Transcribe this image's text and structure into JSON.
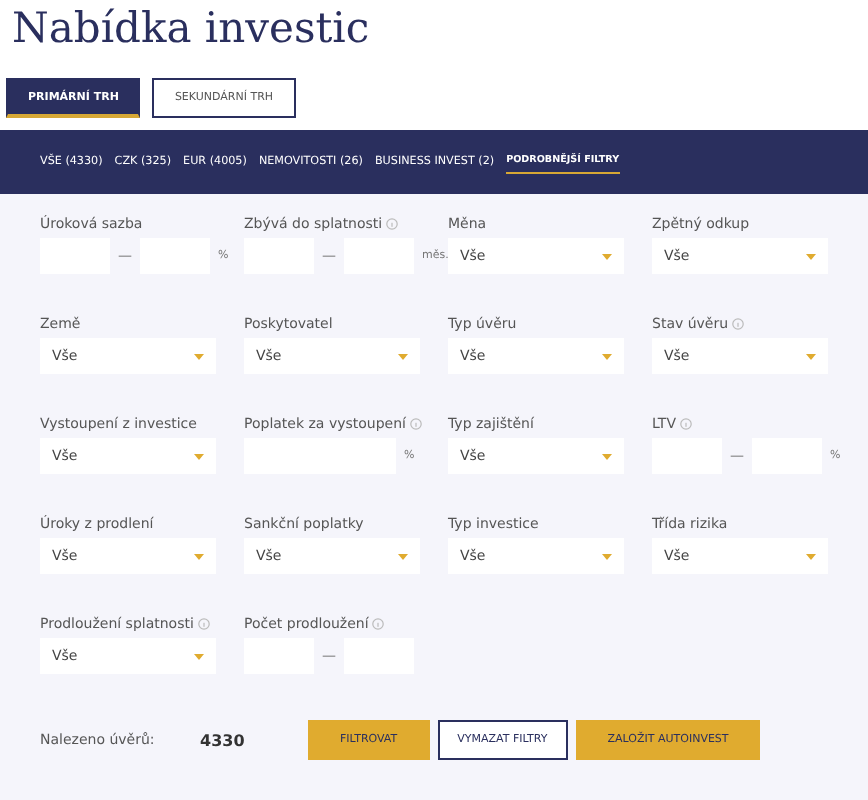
{
  "title": "Nabídka investic",
  "market_tabs": [
    {
      "label": "PRIMÁRNÍ TRH",
      "selected": true
    },
    {
      "label": "SEKUNDÁRNÍ TRH",
      "selected": false
    }
  ],
  "nav": [
    {
      "label": "VŠE (4330)",
      "selected": false,
      "kind": "count"
    },
    {
      "label": "CZK (325)",
      "selected": false,
      "kind": "count"
    },
    {
      "label": "EUR (4005)",
      "selected": false,
      "kind": "count"
    },
    {
      "label": "NEMOVITOSTI (26)",
      "selected": false,
      "kind": "count"
    },
    {
      "label": "BUSINESS INVEST (2)",
      "selected": false,
      "kind": "count"
    },
    {
      "label": "PODROBNĚJŠÍ FILTRY",
      "selected": true,
      "kind": "filters"
    }
  ],
  "filters": [
    {
      "label": "Úroková sazba",
      "info": false,
      "kind": "range",
      "unit": "%"
    },
    {
      "label": "Zbývá do splatnosti",
      "info": true,
      "kind": "range",
      "unit": "měs."
    },
    {
      "label": "Měna",
      "info": false,
      "kind": "select",
      "value": "Vše"
    },
    {
      "label": "Zpětný odkup",
      "info": false,
      "kind": "select",
      "value": "Vše"
    },
    {
      "label": "Země",
      "info": false,
      "kind": "select",
      "value": "Vše"
    },
    {
      "label": "Poskytovatel",
      "info": false,
      "kind": "select",
      "value": "Vše"
    },
    {
      "label": "Typ úvěru",
      "info": false,
      "kind": "select",
      "value": "Vše"
    },
    {
      "label": "Stav úvěru",
      "info": true,
      "kind": "select",
      "value": "Vše"
    },
    {
      "label": "Vystoupení z investice",
      "info": false,
      "kind": "select",
      "value": "Vše"
    },
    {
      "label": "Poplatek za vystoupení",
      "info": true,
      "kind": "single",
      "unit": "%"
    },
    {
      "label": "Typ zajištění",
      "info": false,
      "kind": "select",
      "value": "Vše"
    },
    {
      "label": "LTV",
      "info": true,
      "kind": "range",
      "unit": "%"
    },
    {
      "label": "Úroky z prodlení",
      "info": false,
      "kind": "select",
      "value": "Vše"
    },
    {
      "label": "Sankční poplatky",
      "info": false,
      "kind": "select",
      "value": "Vše"
    },
    {
      "label": "Typ investice",
      "info": false,
      "kind": "select",
      "value": "Vše"
    },
    {
      "label": "Třída rizika",
      "info": false,
      "kind": "select",
      "value": "Vše"
    },
    {
      "label": "Prodloužení splatnosti",
      "info": true,
      "kind": "select",
      "value": "Vše"
    },
    {
      "label": "Počet prodloužení",
      "info": true,
      "kind": "range"
    }
  ],
  "range_separator": "—",
  "found": {
    "label": "Nalezeno úvěrů:",
    "value": "4330"
  },
  "actions": [
    {
      "label": "FILTROVAT",
      "kind": "primary"
    },
    {
      "label": "VYMAZAT FILTRY",
      "kind": "outline"
    },
    {
      "label": "ZALOŽIT AUTOINVEST",
      "kind": "primary"
    }
  ]
}
